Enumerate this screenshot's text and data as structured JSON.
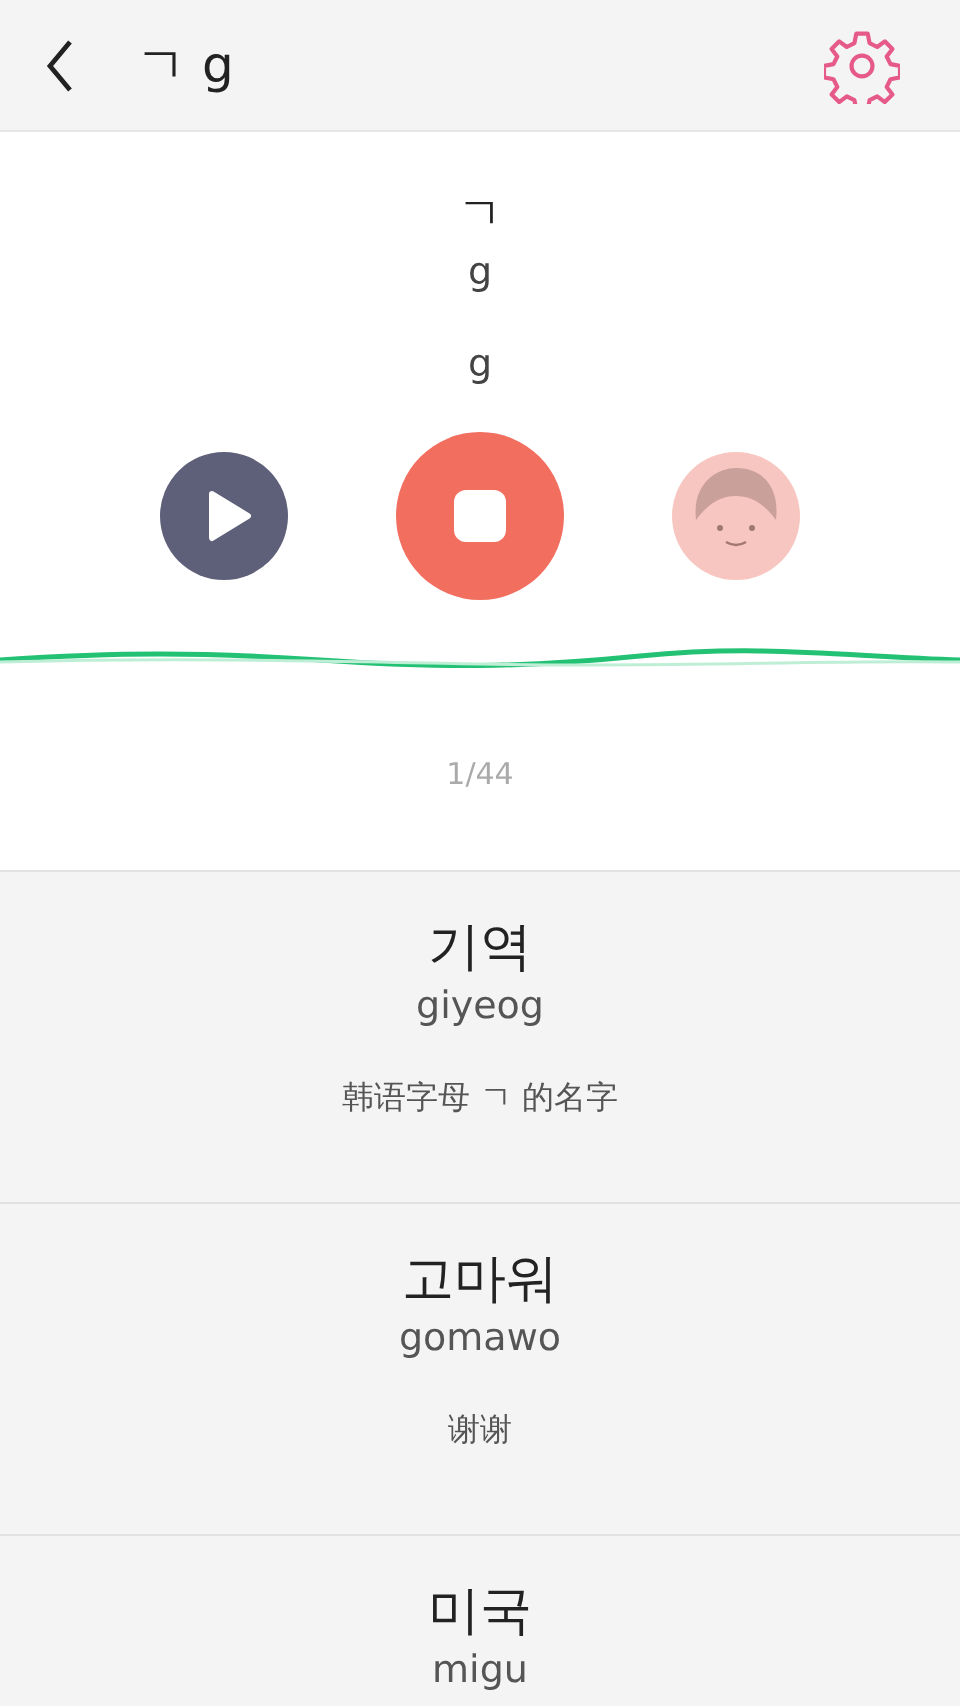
{
  "header": {
    "title": "ㄱ g"
  },
  "letter": {
    "character": "ㄱ",
    "romanization": "g",
    "sound": "g"
  },
  "counter": "1/44",
  "words": [
    {
      "word": "기역",
      "romanization": "giyeog",
      "meaning": "韩语字母 ㄱ 的名字"
    },
    {
      "word": "고마워",
      "romanization": "gomawo",
      "meaning": "谢谢"
    },
    {
      "word": "미국",
      "romanization": "migu"
    }
  ]
}
